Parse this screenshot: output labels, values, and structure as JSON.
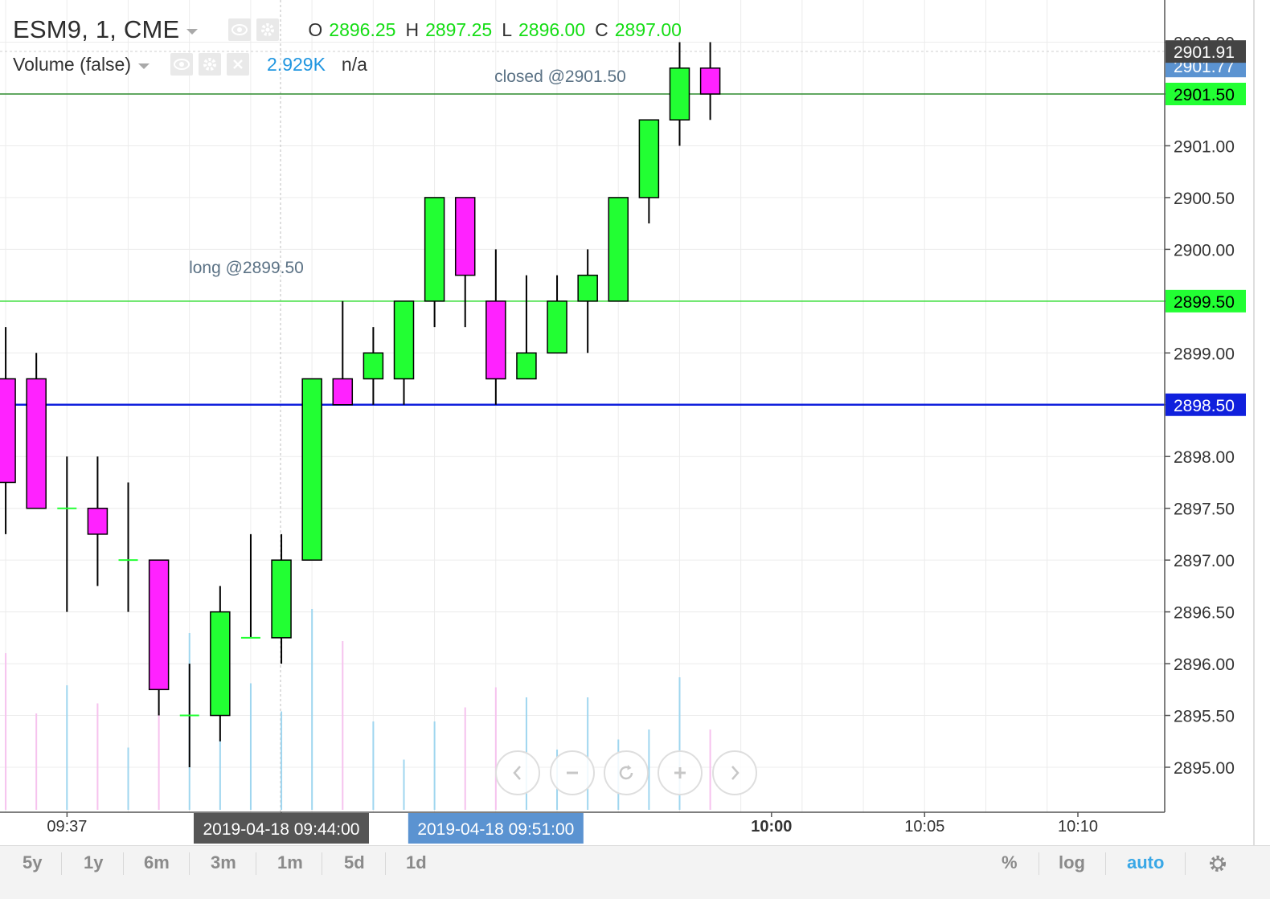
{
  "legend": {
    "symbol": "ESM9, 1, CME",
    "ohlc": [
      {
        "key": "O",
        "value": "2896.25"
      },
      {
        "key": "H",
        "value": "2897.25"
      },
      {
        "key": "L",
        "value": "2896.00"
      },
      {
        "key": "C",
        "value": "2897.00"
      }
    ],
    "volume_label": "Volume (false)",
    "volume_value": "2.929K",
    "volume_na": "n/a"
  },
  "colors": {
    "up": "#22ff33",
    "down": "#ff22ff",
    "long_line": "#33dd33",
    "closed_line": "#2d8c2d",
    "support_line": "#1020dd",
    "vol_up": "#9fd6ef",
    "vol_down": "#f6c2ee"
  },
  "chart_data": {
    "type": "candlestick",
    "symbol": "ESM9",
    "interval": "1",
    "exchange": "CME",
    "y_ticks": [
      "2895.00",
      "2895.50",
      "2896.00",
      "2896.50",
      "2897.00",
      "2897.50",
      "2898.00",
      "2898.50",
      "2899.00",
      "2899.50",
      "2900.00",
      "2900.50",
      "2901.00",
      "2901.50",
      "2902.00"
    ],
    "x_ticks": [
      {
        "label": "09:37",
        "minute": 9.6167
      },
      {
        "label": "09:",
        "minute": 9.7333
      },
      {
        "label": "10:00",
        "minute": 10.0
      },
      {
        "label": "10:05",
        "minute": 10.0833
      },
      {
        "label": "10:10",
        "minute": 10.1667
      }
    ],
    "candles": [
      {
        "time": "09:35",
        "o": 2898.75,
        "h": 2899.25,
        "l": 2897.25,
        "c": 2897.75,
        "vol": 0.78
      },
      {
        "time": "09:36",
        "o": 2898.75,
        "h": 2899.0,
        "l": null,
        "c": 2897.5,
        "vol": 0.48
      },
      {
        "time": "09:37",
        "o": 2897.5,
        "h": 2898.0,
        "l": 2896.5,
        "c": 2897.5,
        "vol": 0.62
      },
      {
        "time": "09:38",
        "o": 2897.5,
        "h": 2898.0,
        "l": 2896.75,
        "c": 2897.25,
        "vol": 0.53
      },
      {
        "time": "09:39",
        "o": 2897.0,
        "h": 2897.75,
        "l": 2896.5,
        "c": 2897.0,
        "vol": 0.31
      },
      {
        "time": "09:40",
        "o": 2897.0,
        "h": 2897.0,
        "l": 2895.5,
        "c": 2895.75,
        "vol": 0.48
      },
      {
        "time": "09:41",
        "o": 2895.5,
        "h": 2896.0,
        "l": 2895.0,
        "c": 2895.5,
        "vol": 0.88
      },
      {
        "time": "09:42",
        "o": 2895.5,
        "h": 2896.75,
        "l": 2895.25,
        "c": 2896.5,
        "vol": 0.35
      },
      {
        "time": "09:43",
        "o": 2896.25,
        "h": 2897.25,
        "l": 2896.25,
        "c": 2896.25,
        "vol": 0.63
      },
      {
        "time": "09:44",
        "o": 2896.25,
        "h": 2897.25,
        "l": 2896.0,
        "c": 2897.0,
        "vol": 0.49
      },
      {
        "time": "09:45",
        "o": 2897.0,
        "h": 2898.75,
        "l": 2897.0,
        "c": 2898.75,
        "vol": 1.0
      },
      {
        "time": "09:46",
        "o": 2898.75,
        "h": 2899.5,
        "l": 2898.5,
        "c": 2898.5,
        "vol": 0.84
      },
      {
        "time": "09:47",
        "o": 2898.75,
        "h": 2899.25,
        "l": 2898.5,
        "c": 2899.0,
        "vol": 0.44
      },
      {
        "time": "09:48",
        "o": 2898.75,
        "h": 2899.5,
        "l": 2898.5,
        "c": 2899.5,
        "vol": 0.25
      },
      {
        "time": "09:49",
        "o": 2899.5,
        "h": 2900.5,
        "l": 2899.25,
        "c": 2900.5,
        "vol": 0.44
      },
      {
        "time": "09:50",
        "o": 2900.5,
        "h": 2900.5,
        "l": 2899.25,
        "c": 2899.75,
        "vol": 0.51
      },
      {
        "time": "09:51",
        "o": 2899.5,
        "h": 2900.0,
        "l": 2898.5,
        "c": 2898.75,
        "vol": 0.61
      },
      {
        "time": "09:52",
        "o": 2898.75,
        "h": 2899.75,
        "l": 2898.75,
        "c": 2899.0,
        "vol": 0.56
      },
      {
        "time": "09:53",
        "o": 2899.0,
        "h": 2899.75,
        "l": 2899.0,
        "c": 2899.5,
        "vol": 0.3
      },
      {
        "time": "09:54",
        "o": 2899.5,
        "h": 2900.0,
        "l": 2899.0,
        "c": 2899.75,
        "vol": 0.56
      },
      {
        "time": "09:55",
        "o": 2899.5,
        "h": 2900.5,
        "l": 2899.5,
        "c": 2900.5,
        "vol": 0.35
      },
      {
        "time": "09:56",
        "o": 2900.5,
        "h": 2901.25,
        "l": 2900.25,
        "c": 2901.25,
        "vol": 0.4
      },
      {
        "time": "09:57",
        "o": 2901.25,
        "h": 2902.0,
        "l": 2901.0,
        "c": 2901.75,
        "vol": 0.66
      },
      {
        "time": "09:58",
        "o": 2901.75,
        "h": 2902.0,
        "l": 2901.25,
        "c": 2901.5,
        "vol": 0.4
      }
    ],
    "horizontal_lines": [
      {
        "price": 2901.5,
        "label": "closed @2901.50",
        "role": "closed"
      },
      {
        "price": 2899.5,
        "label": "long @2899.50",
        "role": "long"
      },
      {
        "price": 2898.5,
        "label": "",
        "role": "support"
      }
    ],
    "price_labels": [
      {
        "price": 2901.91,
        "text": "2901.91",
        "bg": "#444444",
        "fg": "#ffffff"
      },
      {
        "price": 2901.77,
        "text": "2901.77",
        "bg": "#5b93d1",
        "fg": "#ffffff"
      },
      {
        "price": 2901.5,
        "text": "2901.50",
        "bg": "#22ff33",
        "fg": "#000000"
      },
      {
        "price": 2899.5,
        "text": "2899.50",
        "bg": "#22ff33",
        "fg": "#000000"
      },
      {
        "price": 2898.5,
        "text": "2898.50",
        "bg": "#1020dd",
        "fg": "#ffffff"
      }
    ],
    "time_labels": [
      {
        "minute": 9.7333,
        "text": "2019-04-18 09:44:00",
        "bg": "#555555"
      },
      {
        "minute": 9.85,
        "text": "2019-04-18 09:51:00",
        "bg": "#5b93d1"
      }
    ],
    "y_range": [
      2894.5,
      2902.3
    ]
  },
  "bottombar": {
    "timeframes": [
      "5y",
      "1y",
      "6m",
      "3m",
      "1m",
      "5d",
      "1d"
    ],
    "percent": "%",
    "log": "log",
    "auto": "auto"
  }
}
